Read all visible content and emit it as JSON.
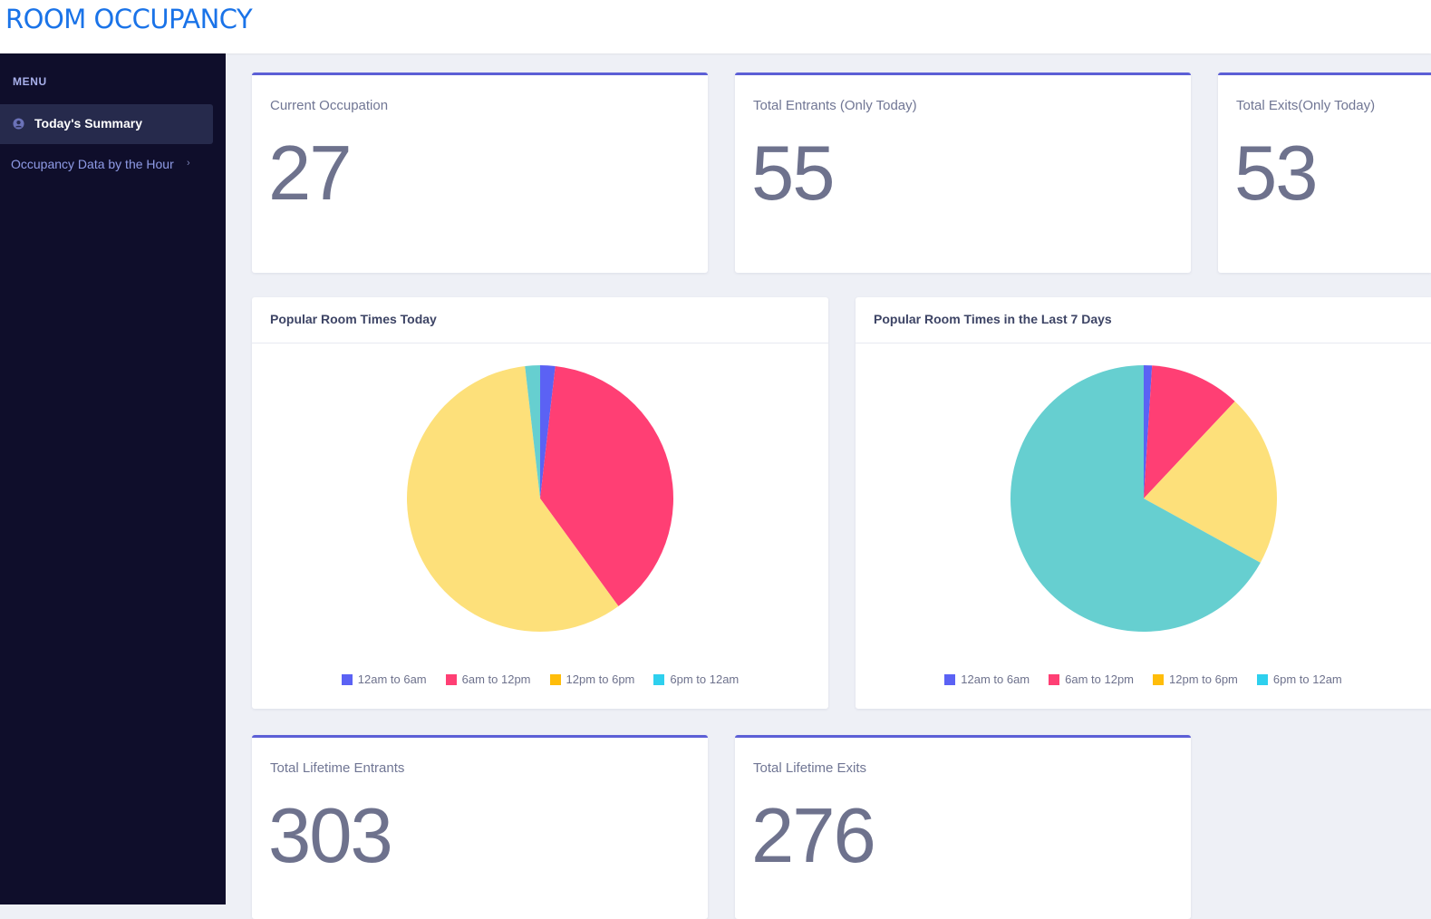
{
  "header": {
    "title": "ROOM OCCUPANCY"
  },
  "sidebar": {
    "menu_title": "MENU",
    "items": [
      {
        "label": "Today's Summary",
        "icon": "user-circle-icon",
        "active": true
      },
      {
        "label": "Occupancy Data by the Hour",
        "icon": "chevron-right-icon",
        "active": false
      }
    ]
  },
  "stats_top": [
    {
      "label": "Current Occupation",
      "value": "27"
    },
    {
      "label": "Total Entrants (Only Today)",
      "value": "55"
    },
    {
      "label": "Total Exits(Only Today)",
      "value": "53"
    }
  ],
  "stats_bottom": [
    {
      "label": "Total Lifetime Entrants",
      "value": "303"
    },
    {
      "label": "Total Lifetime Exits",
      "value": "276"
    }
  ],
  "colors": {
    "accent": "#5c5fd6",
    "series": [
      "#5b62f4",
      "#ff3f74",
      "#fde07a",
      "#66cfd0"
    ],
    "legend": [
      "#5b62f4",
      "#ff3f74",
      "#ffbd0a",
      "#2ed0ee"
    ]
  },
  "chart_data": [
    {
      "type": "pie",
      "title": "Popular Room Times Today",
      "categories": [
        "12am to 6am",
        "6am to 12pm",
        "12pm to 6pm",
        "6pm to 12am"
      ],
      "values": [
        1,
        21,
        32,
        1
      ],
      "legend": "bottom"
    },
    {
      "type": "pie",
      "title": "Popular Room Times in the Last 7 Days",
      "categories": [
        "12am to 6am",
        "6am to 12pm",
        "12pm to 6pm",
        "6pm to 12am"
      ],
      "values": [
        1,
        11,
        21,
        67
      ],
      "legend": "bottom"
    }
  ]
}
